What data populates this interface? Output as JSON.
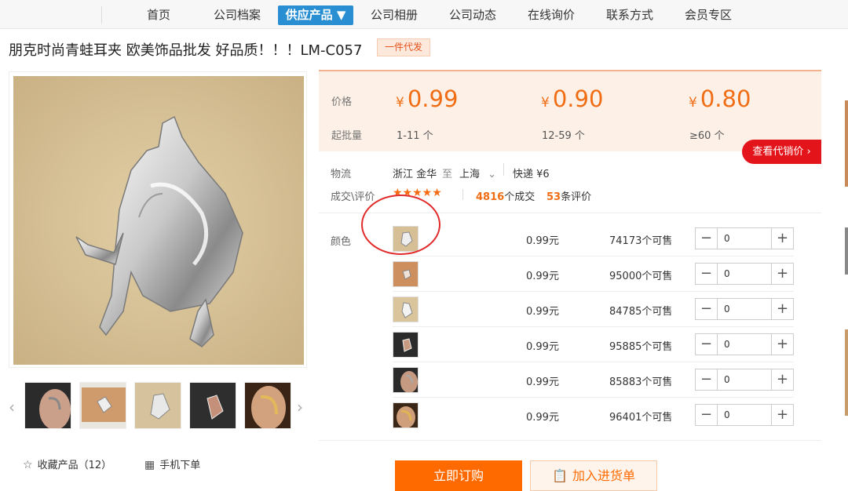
{
  "nav": {
    "items": [
      {
        "label": "首页"
      },
      {
        "label": "公司档案"
      },
      {
        "label": "供应产品 ▼"
      },
      {
        "label": "公司相册"
      },
      {
        "label": "公司动态"
      },
      {
        "label": "在线询价"
      },
      {
        "label": "联系方式"
      },
      {
        "label": "会员专区"
      }
    ],
    "active_index": 2
  },
  "product": {
    "title": "朋克时尚青蛙耳夹 欧美饰品批发 好品质！！！LM-C057",
    "badge": "一件代发"
  },
  "gallery": {
    "thumbs": [
      {
        "icon": "ear-photo"
      },
      {
        "icon": "ring-on-orange"
      },
      {
        "icon": "ring-on-beige"
      },
      {
        "icon": "ring-on-dark"
      },
      {
        "icon": "ear-gold"
      }
    ],
    "prev_icon": "chevron-left-icon",
    "next_icon": "chevron-right-icon"
  },
  "actions": {
    "favorite_label": "收藏产品（12）",
    "mobile_label": "手机下单"
  },
  "pricing": {
    "price_label": "价格",
    "moq_label": "起批量",
    "currency": "¥",
    "tiers": [
      {
        "price": "0.99",
        "qty": "1-11 个"
      },
      {
        "price": "0.90",
        "qty": "12-59 个"
      },
      {
        "price": "0.80",
        "qty": "≥60 个"
      }
    ],
    "agent_price_button": "查看代销价 ›"
  },
  "logistics": {
    "label": "物流",
    "from": "浙江 金华",
    "to_word": "至",
    "to": "上海",
    "express": "快递 ¥6"
  },
  "reviews": {
    "label": "成交\\评价",
    "stars": "★★★★★",
    "deals_count": "4816",
    "deals_suffix": "个成交",
    "reviews_count": "53",
    "reviews_suffix": "条评价"
  },
  "sku": {
    "label": "颜色",
    "rows": [
      {
        "price": "0.99元",
        "stock": "74173个可售",
        "qty": "0"
      },
      {
        "price": "0.99元",
        "stock": "95000个可售",
        "qty": "0"
      },
      {
        "price": "0.99元",
        "stock": "84785个可售",
        "qty": "0"
      },
      {
        "price": "0.99元",
        "stock": "95885个可售",
        "qty": "0"
      },
      {
        "price": "0.99元",
        "stock": "85883个可售",
        "qty": "0"
      },
      {
        "price": "0.99元",
        "stock": "96401个可售",
        "qty": "0"
      }
    ]
  },
  "buttons": {
    "buy_now": "立即订购",
    "add_to_cart": "加入进货单"
  },
  "colors": {
    "accent": "#ff6a00",
    "nav_active": "#2a8fd2",
    "annotation": "#e12b2b"
  }
}
